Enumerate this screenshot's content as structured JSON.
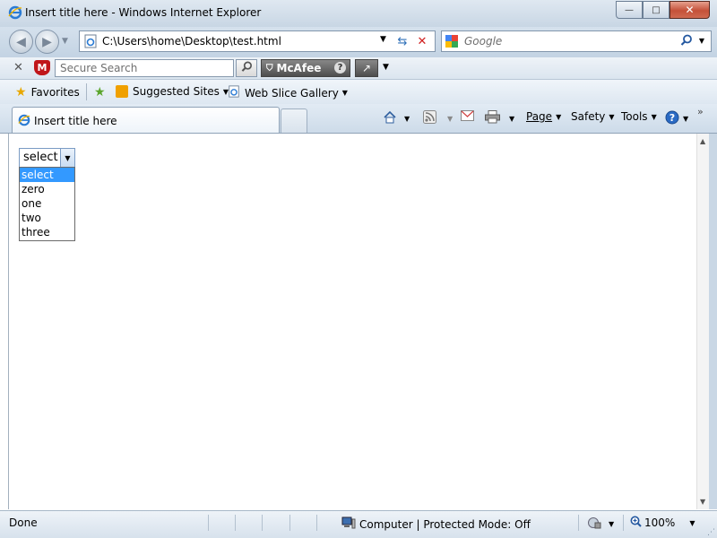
{
  "window": {
    "title": "Insert title here - Windows Internet Explorer",
    "minimize_glyph": "—",
    "maximize_glyph": "□",
    "close_glyph": "✕"
  },
  "nav": {
    "address": "C:\\Users\\home\\Desktop\\test.html",
    "search_placeholder": "Google"
  },
  "mcafee": {
    "search_placeholder": "Secure Search",
    "brand": "McAfee",
    "brand_mark": "M"
  },
  "favorites": {
    "favorites_label": "Favorites",
    "suggested_sites": "Suggested Sites",
    "web_slice_gallery": "Web Slice Gallery"
  },
  "tabs": {
    "active_tab_label": "Insert title here"
  },
  "commands": {
    "page": "Page",
    "safety": "Safety",
    "tools": "Tools"
  },
  "page": {
    "select": {
      "value": "select",
      "options": [
        "select",
        "zero",
        "one",
        "two",
        "three"
      ],
      "highlighted": "select"
    }
  },
  "status": {
    "text": "Done",
    "zone": "Computer | Protected Mode: Off",
    "zoom": "100%"
  },
  "colors": {
    "selection_blue": "#3399ff",
    "close_button_red": "#c45139"
  }
}
